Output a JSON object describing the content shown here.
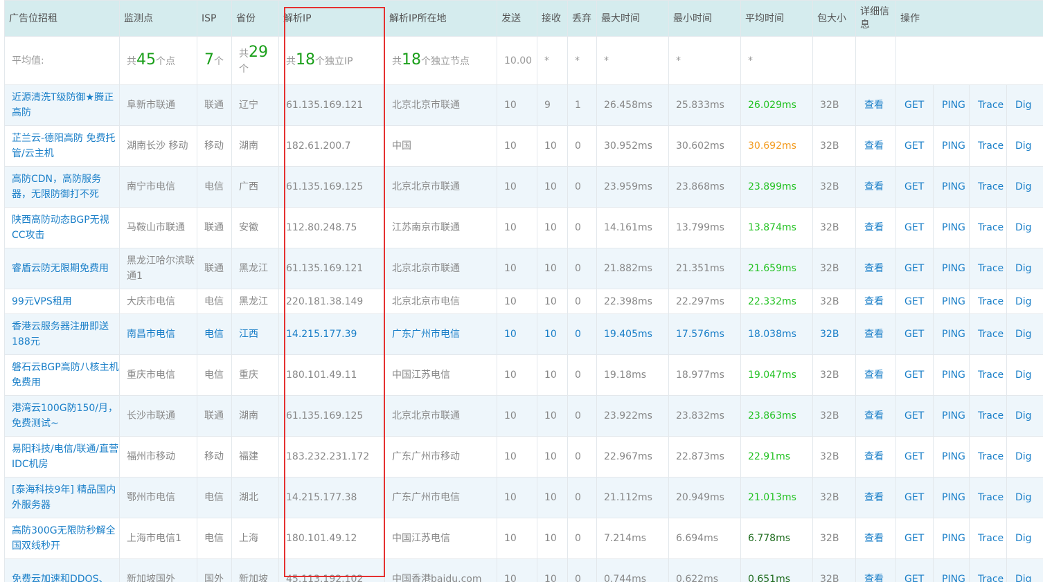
{
  "headers": {
    "ad": "广告位招租",
    "monitor": "监测点",
    "isp": "ISP",
    "province": "省份",
    "ip": "解析IP",
    "ip_location": "解析IP所在地",
    "sent": "发送",
    "received": "接收",
    "dropped": "丢弃",
    "max_time": "最大时间",
    "min_time": "最小时间",
    "avg_time": "平均时间",
    "packet_size": "包大小",
    "detail": "详细信息",
    "actions": "操作"
  },
  "average": {
    "label": "平均值:",
    "points_prefix": "共",
    "points_count": "45",
    "points_suffix": "个点",
    "isp_count": "7",
    "isp_suffix": "个",
    "province_prefix": "共",
    "province_count": "29",
    "province_suffix": "个",
    "ip_prefix": "共",
    "ip_count": "18",
    "ip_suffix": "个独立IP",
    "node_prefix": "共",
    "node_count": "18",
    "node_suffix": "个独立节点",
    "sent": "10.00",
    "received": "*",
    "dropped": "*",
    "max": "*",
    "min": "*",
    "avg": "*"
  },
  "actions": {
    "view": "查看",
    "get": "GET",
    "ping": "PING",
    "trace": "Trace",
    "dig": "Dig"
  },
  "rows": [
    {
      "ad": "近源清洗T级防御★腾正高防",
      "monitor": "阜新市联通",
      "isp": "联通",
      "province": "辽宁",
      "ip": "61.135.169.121",
      "location": "北京北京市联通",
      "sent": "10",
      "recv": "9",
      "drop": "1",
      "max": "26.458ms",
      "min": "25.833ms",
      "avg": "26.029ms",
      "size": "32B",
      "avg_color": "g-light"
    },
    {
      "ad": "芷兰云-德阳高防 免费托管/云主机",
      "monitor": "湖南长沙 移动",
      "isp": "移动",
      "province": "湖南",
      "ip": "182.61.200.7",
      "location": "中国",
      "sent": "10",
      "recv": "10",
      "drop": "0",
      "max": "30.952ms",
      "min": "30.602ms",
      "avg": "30.692ms",
      "size": "32B",
      "avg_color": "g-orange"
    },
    {
      "ad": "高防CDN，高防服务器，无限防御打不死",
      "monitor": "南宁市电信",
      "isp": "电信",
      "province": "广西",
      "ip": "61.135.169.125",
      "location": "北京北京市联通",
      "sent": "10",
      "recv": "10",
      "drop": "0",
      "max": "23.959ms",
      "min": "23.868ms",
      "avg": "23.899ms",
      "size": "32B",
      "avg_color": "g-light"
    },
    {
      "ad": "陕西高防动态BGP无视CC攻击",
      "monitor": "马鞍山市联通",
      "isp": "联通",
      "province": "安徽",
      "ip": "112.80.248.75",
      "location": "江苏南京市联通",
      "sent": "10",
      "recv": "10",
      "drop": "0",
      "max": "14.161ms",
      "min": "13.799ms",
      "avg": "13.874ms",
      "size": "32B",
      "avg_color": "g-light"
    },
    {
      "ad": "睿盾云防无限期免费用",
      "monitor": "黑龙江哈尔滨联通1",
      "isp": "联通",
      "province": "黑龙江",
      "ip": "61.135.169.121",
      "location": "北京北京市联通",
      "sent": "10",
      "recv": "10",
      "drop": "0",
      "max": "21.882ms",
      "min": "21.351ms",
      "avg": "21.659ms",
      "size": "32B",
      "avg_color": "g-light"
    },
    {
      "ad": "99元VPS租用",
      "monitor": "大庆市电信",
      "isp": "电信",
      "province": "黑龙江",
      "ip": "220.181.38.149",
      "location": "北京北京市电信",
      "sent": "10",
      "recv": "10",
      "drop": "0",
      "max": "22.398ms",
      "min": "22.297ms",
      "avg": "22.332ms",
      "size": "32B",
      "avg_color": "g-light",
      "short": true
    },
    {
      "ad": "香港云服务器注册即送188元",
      "monitor": "南昌市电信",
      "isp": "电信",
      "province": "江西",
      "ip": "14.215.177.39",
      "location": "广东广州市电信",
      "sent": "10",
      "recv": "10",
      "drop": "0",
      "max": "19.405ms",
      "min": "17.576ms",
      "avg": "18.038ms",
      "size": "32B",
      "avg_color": "g-light",
      "highlight": true
    },
    {
      "ad": "磐石云BGP高防八核主机免费用",
      "monitor": "重庆市电信",
      "isp": "电信",
      "province": "重庆",
      "ip": "180.101.49.11",
      "location": "中国江苏电信",
      "sent": "10",
      "recv": "10",
      "drop": "0",
      "max": "19.18ms",
      "min": "18.977ms",
      "avg": "19.047ms",
      "size": "32B",
      "avg_color": "g-light"
    },
    {
      "ad": "港湾云100G防150/月，免费测试~",
      "monitor": "长沙市联通",
      "isp": "联通",
      "province": "湖南",
      "ip": "61.135.169.125",
      "location": "北京北京市联通",
      "sent": "10",
      "recv": "10",
      "drop": "0",
      "max": "23.922ms",
      "min": "23.832ms",
      "avg": "23.863ms",
      "size": "32B",
      "avg_color": "g-light"
    },
    {
      "ad": "易阳科技/电信/联通/直营IDC机房",
      "monitor": "福州市移动",
      "isp": "移动",
      "province": "福建",
      "ip": "183.232.231.172",
      "location": "广东广州市移动",
      "sent": "10",
      "recv": "10",
      "drop": "0",
      "max": "22.967ms",
      "min": "22.873ms",
      "avg": "22.91ms",
      "size": "32B",
      "avg_color": "g-light"
    },
    {
      "ad": "[泰海科技9年] 精品国内外服务器",
      "monitor": "鄂州市电信",
      "isp": "电信",
      "province": "湖北",
      "ip": "14.215.177.38",
      "location": "广东广州市电信",
      "sent": "10",
      "recv": "10",
      "drop": "0",
      "max": "21.112ms",
      "min": "20.949ms",
      "avg": "21.013ms",
      "size": "32B",
      "avg_color": "g-light"
    },
    {
      "ad": "高防300G无限防秒解全国双线秒开",
      "monitor": "上海市电信1",
      "isp": "电信",
      "province": "上海",
      "ip": "180.101.49.12",
      "location": "中国江苏电信",
      "sent": "10",
      "recv": "10",
      "drop": "0",
      "max": "7.214ms",
      "min": "6.694ms",
      "avg": "6.778ms",
      "size": "32B",
      "avg_color": "g-dark"
    },
    {
      "ad": "免费云加速和DDOS、",
      "monitor": "新加坡国外",
      "isp": "国外",
      "province": "新加坡",
      "ip": "45.113.192.102",
      "location": "中国香港baidu.com",
      "sent": "10",
      "recv": "10",
      "drop": "0",
      "max": "0.744ms",
      "min": "0.622ms",
      "avg": "0.651ms",
      "size": "32B",
      "avg_color": "g-dark"
    }
  ]
}
